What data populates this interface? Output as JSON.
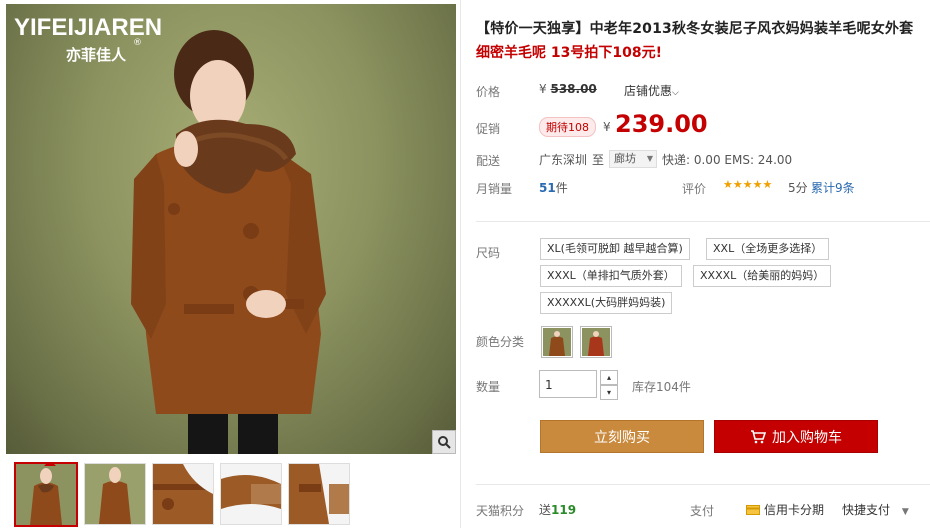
{
  "brand": {
    "logo_en": "YIFEIJIAREN",
    "logo_cn": "亦菲佳人",
    "logo_mark": "®"
  },
  "product": {
    "title": "【特价一天独享】中老年2013秋冬女装尼子风衣妈妈装羊毛呢女外套",
    "subtitle": "细密羊毛呢 13号拍下108元!"
  },
  "price": {
    "label": "价格",
    "currency": "¥",
    "original": "538.00",
    "store_discount": "店铺优惠"
  },
  "promo": {
    "label": "促销",
    "badge": "期待108",
    "currency": "¥",
    "price": "239.00"
  },
  "shipping": {
    "label": "配送",
    "from": "广东深圳",
    "to_word": "至",
    "destination": "廊坊",
    "fee": "快递: 0.00 EMS: 24.00"
  },
  "sales": {
    "label": "月销量",
    "count": "51",
    "unit": "件"
  },
  "rating": {
    "label": "评价",
    "stars": "★★★★★",
    "score": "5分",
    "total": "累计9条"
  },
  "size": {
    "label": "尺码",
    "options": [
      "XL(毛领可脱卸 越早越合算)",
      "XXL（全场更多选择）",
      "XXXL（单排扣气质外套）",
      "XXXXL（给美丽的妈妈）",
      "XXXXXL(大码胖妈妈装)"
    ]
  },
  "color": {
    "label": "颜色分类"
  },
  "quantity": {
    "label": "数量",
    "value": "1",
    "stock": "库存104件"
  },
  "actions": {
    "buy": "立刻购买",
    "cart": "加入购物车"
  },
  "footer": {
    "points_label": "天猫积分",
    "points_prefix": "送",
    "points": "119",
    "pay_label": "支付",
    "credit": "信用卡分期",
    "quick_pay": "快捷支付"
  },
  "colors": {
    "accent_red": "#c40000",
    "buy_orange": "#c98a3e",
    "coat_brown": "#8f4a1b"
  }
}
